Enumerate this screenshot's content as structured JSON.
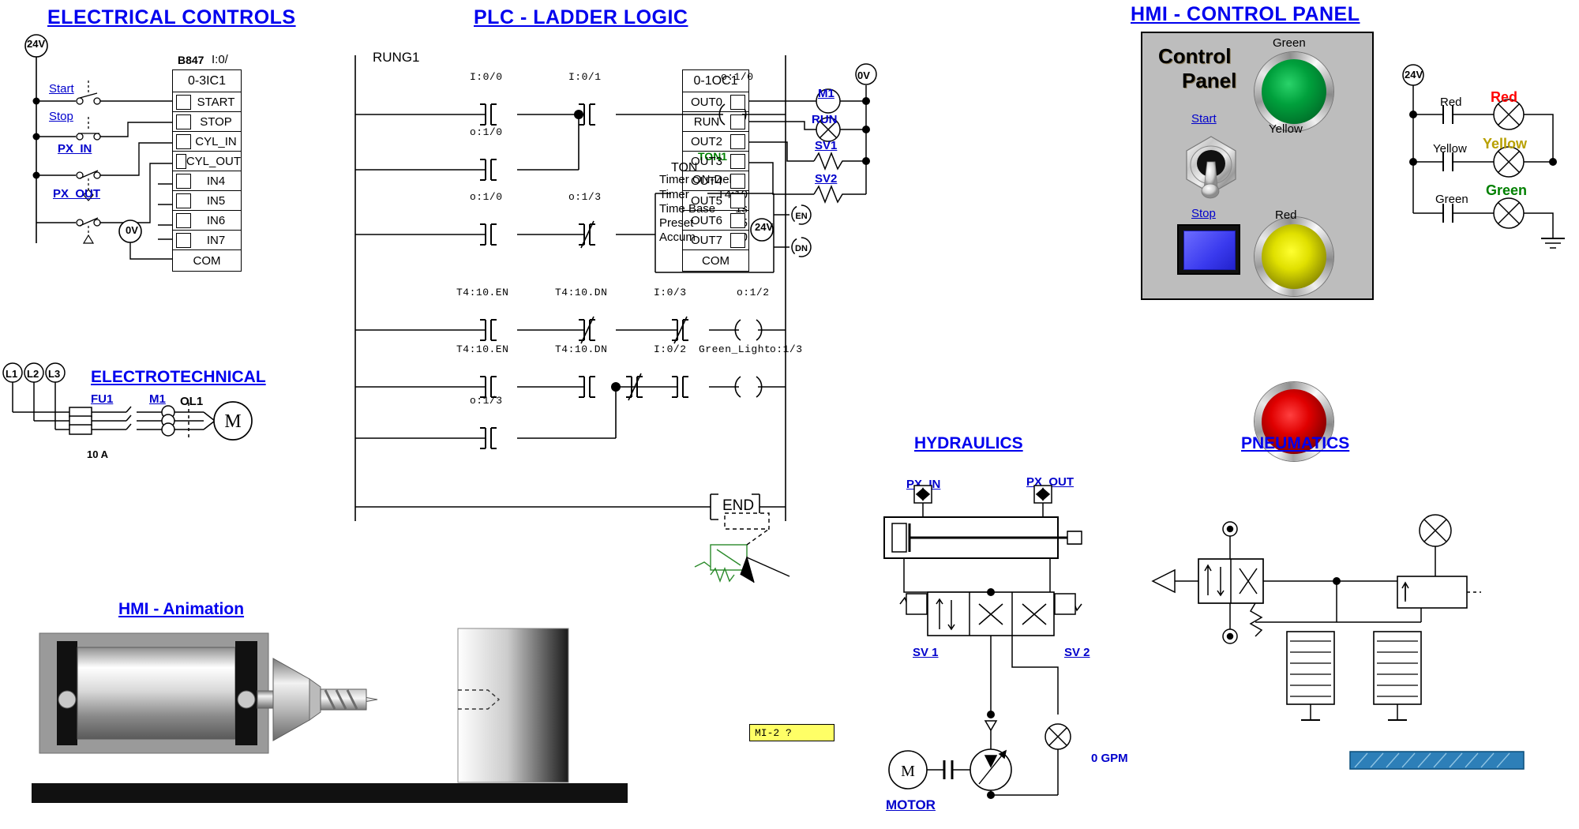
{
  "sections": {
    "electrical_controls": "ELECTRICAL CONTROLS",
    "plc_ladder": "PLC - LADDER LOGIC",
    "hmi_control_panel": "HMI  - CONTROL PANEL",
    "electrotechnical": "ELECTROTECHNICAL",
    "hmi_animation": "HMI - Animation",
    "hydraulics": "HYDRAULICS",
    "pneumatics": "PNEUMATICS"
  },
  "electrical": {
    "supply_24v": "24V",
    "supply_0v": "0V",
    "module_ref": "B847",
    "module_addr": "I:0/",
    "module_name": "0-3IC1",
    "switches": [
      {
        "name": "Start"
      },
      {
        "name": "Stop"
      },
      {
        "name": "PX_IN"
      },
      {
        "name": "PX_OUT"
      }
    ],
    "terminals": [
      "START",
      "STOP",
      "CYL_IN",
      "CYL_OUT",
      "IN4",
      "IN5",
      "IN6",
      "IN7",
      "COM"
    ]
  },
  "output_module": {
    "name": "0-1OC1",
    "terminals": [
      "OUT0",
      "RUN",
      "OUT2",
      "OUT3",
      "OUT4",
      "OUT5",
      "OUT6",
      "OUT7",
      "COM"
    ],
    "devices": [
      "M1",
      "RUN",
      "SV1",
      "SV2"
    ],
    "supply_0v": "0V",
    "supply_24v": "24V"
  },
  "ladder": {
    "rung_label": "RUNG1",
    "end_label": "END",
    "rung1": {
      "contacts": [
        "I:0/0",
        "I:0/1"
      ],
      "branch": "o:1/0",
      "coil": "o:1/0"
    },
    "rung2": {
      "contacts": [
        "o:1/0",
        "o:1/3"
      ],
      "timer": {
        "instance": "TON1",
        "type": "TON",
        "desc": "Timer ON-Delay",
        "rows": [
          {
            "label": "Timer",
            "value": "T4:10"
          },
          {
            "label": "Time Base",
            "value": "1s"
          },
          {
            "label": "Preset",
            "value": "5"
          },
          {
            "label": "Accum",
            "value": "0"
          }
        ],
        "outputs": [
          "EN",
          "DN"
        ]
      }
    },
    "rung3": {
      "contacts": [
        "T4:10.EN",
        "T4:10.DN",
        "I:0/3"
      ],
      "coil": "o:1/2"
    },
    "rung4": {
      "contacts": [
        "T4:10.EN",
        "T4:10.DN",
        "I:0/2"
      ],
      "extra_contact_label": "Green_Light",
      "branch": "o:1/3",
      "coil": "o:1/3"
    }
  },
  "hmi": {
    "title_line1": "Control",
    "title_line2": "Panel",
    "start_label": "Start",
    "stop_label": "Stop",
    "lamps": [
      {
        "name": "Green",
        "color": "#00a03c"
      },
      {
        "name": "Yellow",
        "color": "#e8e800"
      },
      {
        "name": "Red",
        "color": "#e00000"
      }
    ]
  },
  "lamp_circuit": {
    "supply_24v": "24V",
    "rows": [
      {
        "contact": "Red",
        "lamp": "Red",
        "color": "#ff0000"
      },
      {
        "contact": "Yellow",
        "lamp": "Yellow",
        "color": "#b8a000"
      },
      {
        "contact": "Green",
        "lamp": "Green",
        "color": "#008000"
      }
    ]
  },
  "electrotechnical": {
    "phases": [
      "L1",
      "L2",
      "L3"
    ],
    "fuse": "FU1",
    "contactor": "M1",
    "overload": "OL1",
    "fuse_rating": "10 A",
    "motor_symbol": "M"
  },
  "hydraulics": {
    "px_in": "PX_IN",
    "px_out": "PX_OUT",
    "sv1": "SV 1",
    "sv2": "SV 2",
    "motor": "MOTOR",
    "motor_symbol": "M",
    "flow": "0 GPM",
    "note": "MI-2    ?"
  }
}
